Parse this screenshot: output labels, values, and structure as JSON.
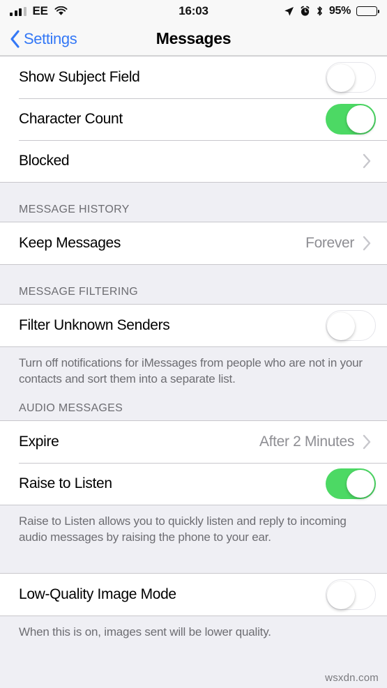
{
  "status_bar": {
    "carrier": "EE",
    "time": "16:03",
    "battery_percent": "95%",
    "signal_icon": "cellular-signal-icon",
    "wifi_icon": "wifi-icon",
    "location_icon": "location-arrow-icon",
    "alarm_icon": "alarm-clock-icon",
    "bluetooth_icon": "bluetooth-icon",
    "battery_icon": "battery-icon"
  },
  "nav": {
    "back_label": "Settings",
    "title": "Messages",
    "back_icon": "chevron-left-icon",
    "accent_color": "#3478F6"
  },
  "colors": {
    "toggle_on": "#4CD964",
    "group_background": "#EFEFF4",
    "row_background": "#FFFFFF",
    "separator": "#C8C7CC",
    "secondary_text": "#8E8E93",
    "header_text": "#6D6D72"
  },
  "sections": [
    {
      "header": "",
      "rows": [
        {
          "label": "Show Subject Field",
          "control": "toggle",
          "value": "off"
        },
        {
          "label": "Character Count",
          "control": "toggle",
          "value": "on"
        },
        {
          "label": "Blocked",
          "control": "disclosure",
          "value": ""
        }
      ],
      "footer": ""
    },
    {
      "header": "MESSAGE HISTORY",
      "rows": [
        {
          "label": "Keep Messages",
          "control": "disclosure",
          "value": "Forever"
        }
      ],
      "footer": ""
    },
    {
      "header": "MESSAGE FILTERING",
      "rows": [
        {
          "label": "Filter Unknown Senders",
          "control": "toggle",
          "value": "off"
        }
      ],
      "footer": "Turn off notifications for iMessages from people who are not in your contacts and sort them into a separate list."
    },
    {
      "header": "AUDIO MESSAGES",
      "rows": [
        {
          "label": "Expire",
          "control": "disclosure",
          "value": "After 2 Minutes"
        },
        {
          "label": "Raise to Listen",
          "control": "toggle",
          "value": "on"
        }
      ],
      "footer": "Raise to Listen allows you to quickly listen and reply to incoming audio messages by raising the phone to your ear."
    },
    {
      "header": "",
      "rows": [
        {
          "label": "Low-Quality Image Mode",
          "control": "toggle",
          "value": "off"
        }
      ],
      "footer": "When this is on, images sent will be lower quality."
    }
  ],
  "watermark": "wsxdn.com"
}
